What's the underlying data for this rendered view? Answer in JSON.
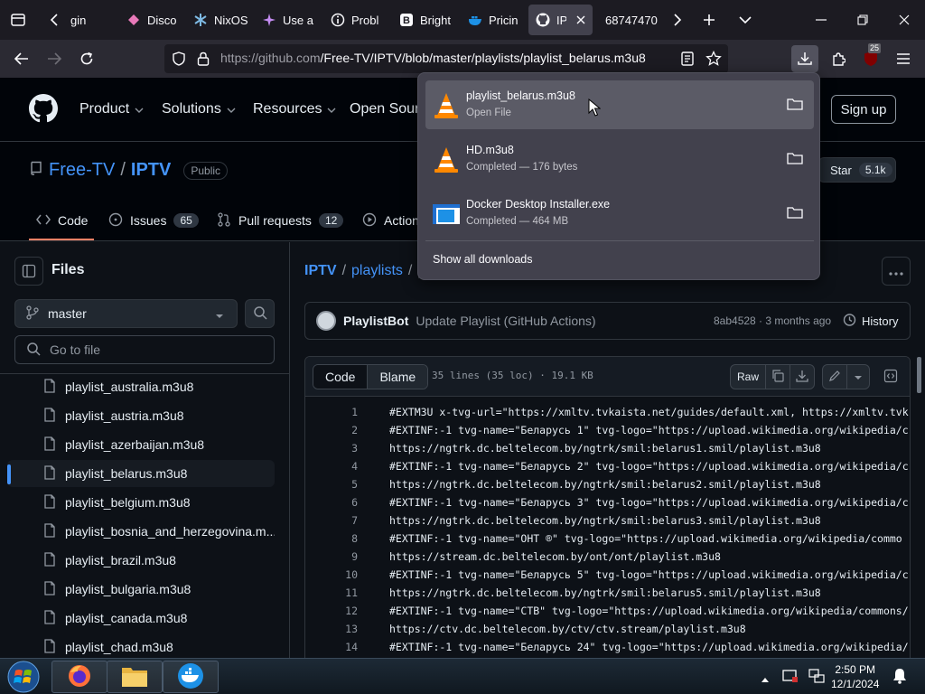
{
  "browser": {
    "tabs": [
      {
        "label": "gin"
      },
      {
        "label": "Disco"
      },
      {
        "label": "NixOS"
      },
      {
        "label": "Use a"
      },
      {
        "label": "Probl"
      },
      {
        "label": "Bright"
      },
      {
        "label": "Pricin"
      },
      {
        "label": "IPTV",
        "active": true
      },
      {
        "label": "68747470"
      }
    ],
    "url_host": "https://github.com",
    "url_path": "/Free-TV/IPTV/blob/master/playlists/playlist_belarus.m3u8",
    "extensions_badge": "25"
  },
  "downloads": {
    "items": [
      {
        "name": "playlist_belarus.m3u8",
        "status": "Open File"
      },
      {
        "name": "HD.m3u8",
        "status": "Completed — 176 bytes"
      },
      {
        "name": "Docker Desktop Installer.exe",
        "status": "Completed — 464 MB"
      }
    ],
    "show_all": "Show all downloads"
  },
  "github": {
    "nav": [
      "Product",
      "Solutions",
      "Resources",
      "Open Sour"
    ],
    "signup": "Sign up",
    "owner": "Free-TV",
    "repo": "IPTV",
    "visibility": "Public",
    "star_label": "Star",
    "star_count": "5.1k",
    "tabs": [
      {
        "label": "Code"
      },
      {
        "label": "Issues",
        "count": "65"
      },
      {
        "label": "Pull requests",
        "count": "12"
      },
      {
        "label": "Action"
      }
    ]
  },
  "sidebar": {
    "title": "Files",
    "branch": "master",
    "goto_placeholder": "Go to file",
    "files": [
      "playlist_australia.m3u8",
      "playlist_austria.m3u8",
      "playlist_azerbaijan.m3u8",
      "playlist_belarus.m3u8",
      "playlist_belgium.m3u8",
      "playlist_bosnia_and_herzegovina.m...",
      "playlist_brazil.m3u8",
      "playlist_bulgaria.m3u8",
      "playlist_canada.m3u8",
      "playlist_chad.m3u8"
    ],
    "selected_index": 3
  },
  "breadcrumb": [
    "IPTV",
    "playlists",
    "p"
  ],
  "commit": {
    "author": "PlaylistBot",
    "message": "Update Playlist (GitHub Actions)",
    "sha_time": "8ab4528 · 3 months ago",
    "history": "History"
  },
  "code": {
    "tab_code": "Code",
    "tab_blame": "Blame",
    "loc": "35 lines (35 loc) · 19.1 KB",
    "raw": "Raw",
    "lines": [
      "#EXTM3U x-tvg-url=\"https://xmltv.tvkaista.net/guides/default.xml, https://xmltv.tvk",
      "#EXTINF:-1 tvg-name=\"Беларусь 1\" tvg-logo=\"https://upload.wikimedia.org/wikipedia/c",
      "https://ngtrk.dc.beltelecom.by/ngtrk/smil:belarus1.smil/playlist.m3u8",
      "#EXTINF:-1 tvg-name=\"Беларусь 2\" tvg-logo=\"https://upload.wikimedia.org/wikipedia/c",
      "https://ngtrk.dc.beltelecom.by/ngtrk/smil:belarus2.smil/playlist.m3u8",
      "#EXTINF:-1 tvg-name=\"Беларусь 3\" tvg-logo=\"https://upload.wikimedia.org/wikipedia/c",
      "https://ngtrk.dc.beltelecom.by/ngtrk/smil:belarus3.smil/playlist.m3u8",
      "#EXTINF:-1 tvg-name=\"ОНТ ®\" tvg-logo=\"https://upload.wikimedia.org/wikipedia/commo",
      "https://stream.dc.beltelecom.by/ont/ont/playlist.m3u8",
      "#EXTINF:-1 tvg-name=\"Беларусь 5\" tvg-logo=\"https://upload.wikimedia.org/wikipedia/c",
      "https://ngtrk.dc.beltelecom.by/ngtrk/smil:belarus5.smil/playlist.m3u8",
      "#EXTINF:-1 tvg-name=\"СТВ\" tvg-logo=\"https://upload.wikimedia.org/wikipedia/commons/",
      "https://ctv.dc.beltelecom.by/ctv/ctv.stream/playlist.m3u8",
      "#EXTINF:-1 tvg-name=\"Беларусь 24\" tvg-logo=\"https://upload.wikimedia.org/wikipedia/"
    ]
  },
  "taskbar": {
    "time": "2:50 PM",
    "date": "12/1/2024"
  }
}
